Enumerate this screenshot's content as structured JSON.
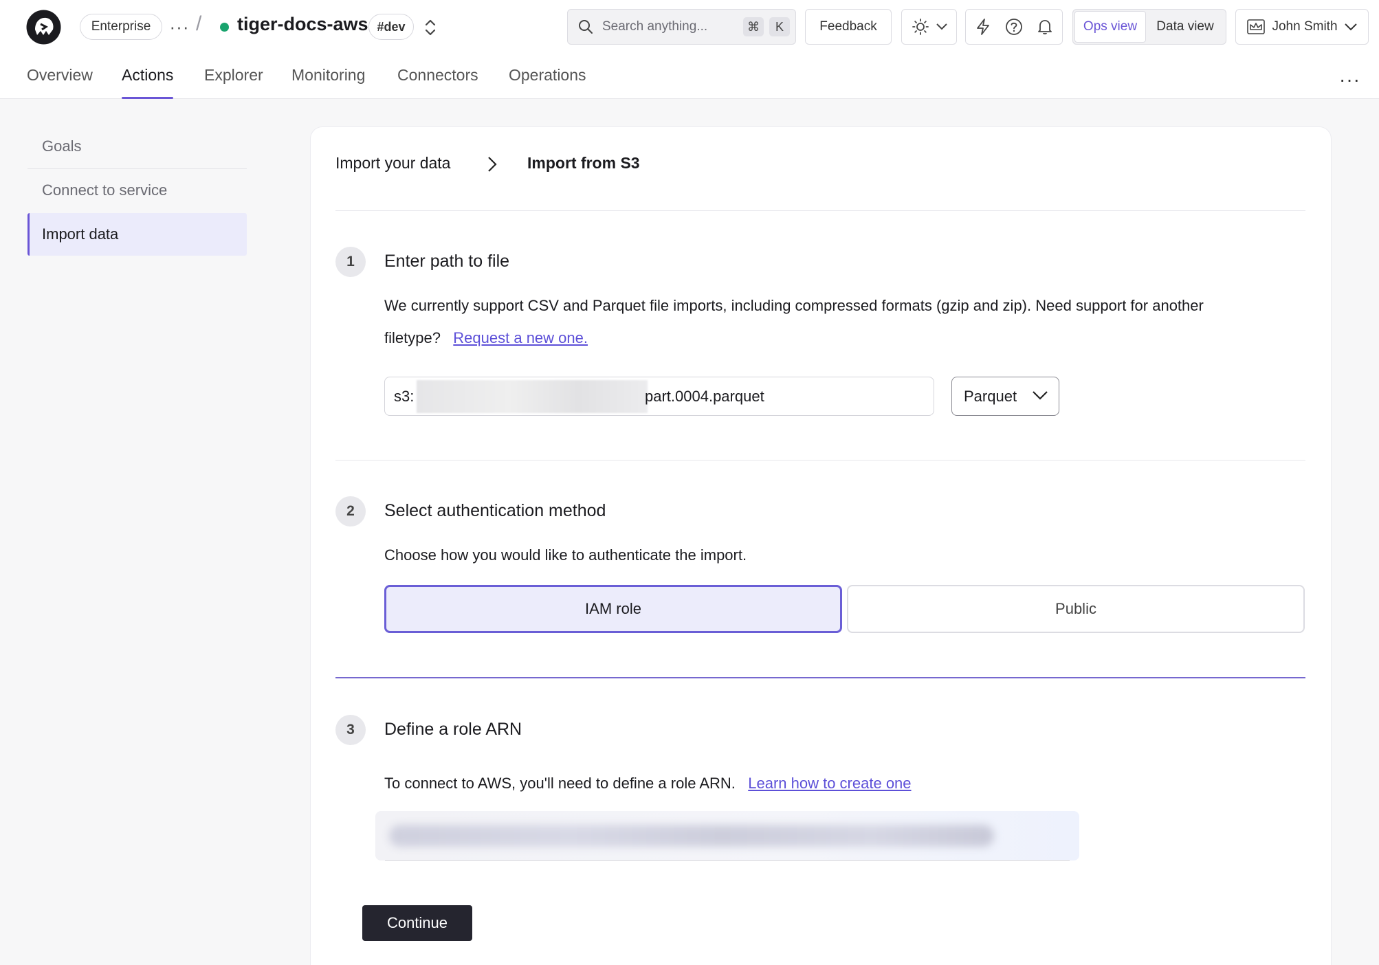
{
  "header": {
    "plan_badge": "Enterprise",
    "more_label": "···",
    "separator": "/",
    "service_name": "tiger-docs-aws",
    "environment_badge": "#dev",
    "status_color": "#18a36d",
    "search": {
      "placeholder": "Search anything...",
      "shortcut_mod": "⌘",
      "shortcut_key": "K"
    },
    "feedback_label": "Feedback",
    "views": {
      "ops": "Ops view",
      "data": "Data view",
      "active": "ops"
    },
    "user_name": "John Smith"
  },
  "nav": {
    "tabs": [
      {
        "label": "Overview"
      },
      {
        "label": "Actions",
        "active": true
      },
      {
        "label": "Explorer"
      },
      {
        "label": "Monitoring"
      },
      {
        "label": "Connectors"
      },
      {
        "label": "Operations"
      }
    ],
    "more_label": "···"
  },
  "sidebar": {
    "items": [
      {
        "label": "Goals"
      },
      {
        "label": "Connect to service"
      },
      {
        "label": "Import data",
        "active": true
      }
    ]
  },
  "breadcrumb": {
    "parent": "Import your data",
    "current": "Import from S3"
  },
  "steps": {
    "one": {
      "number": "1",
      "title": "Enter path to file",
      "description_line1": "We currently support CSV and Parquet file imports, including compressed formats (gzip and zip). Need support for another",
      "description_line2": "filetype?",
      "link": "Request a new one.",
      "path_prefix": "s3:",
      "path_suffix": "part.0004.parquet",
      "format_value": "Parquet"
    },
    "two": {
      "number": "2",
      "title": "Select authentication method",
      "description": "Choose how you would like to authenticate the import.",
      "options": {
        "iam": "IAM role",
        "public": "Public"
      },
      "selected": "IAM role"
    },
    "three": {
      "number": "3",
      "title": "Define a role ARN",
      "description": "To connect to AWS, you'll need to define a role ARN.",
      "link": "Learn how to create one"
    }
  },
  "continue_label": "Continue",
  "colors": {
    "accent": "#6a55d6",
    "link": "#5c4fd8",
    "primary_button": "#25252f"
  }
}
